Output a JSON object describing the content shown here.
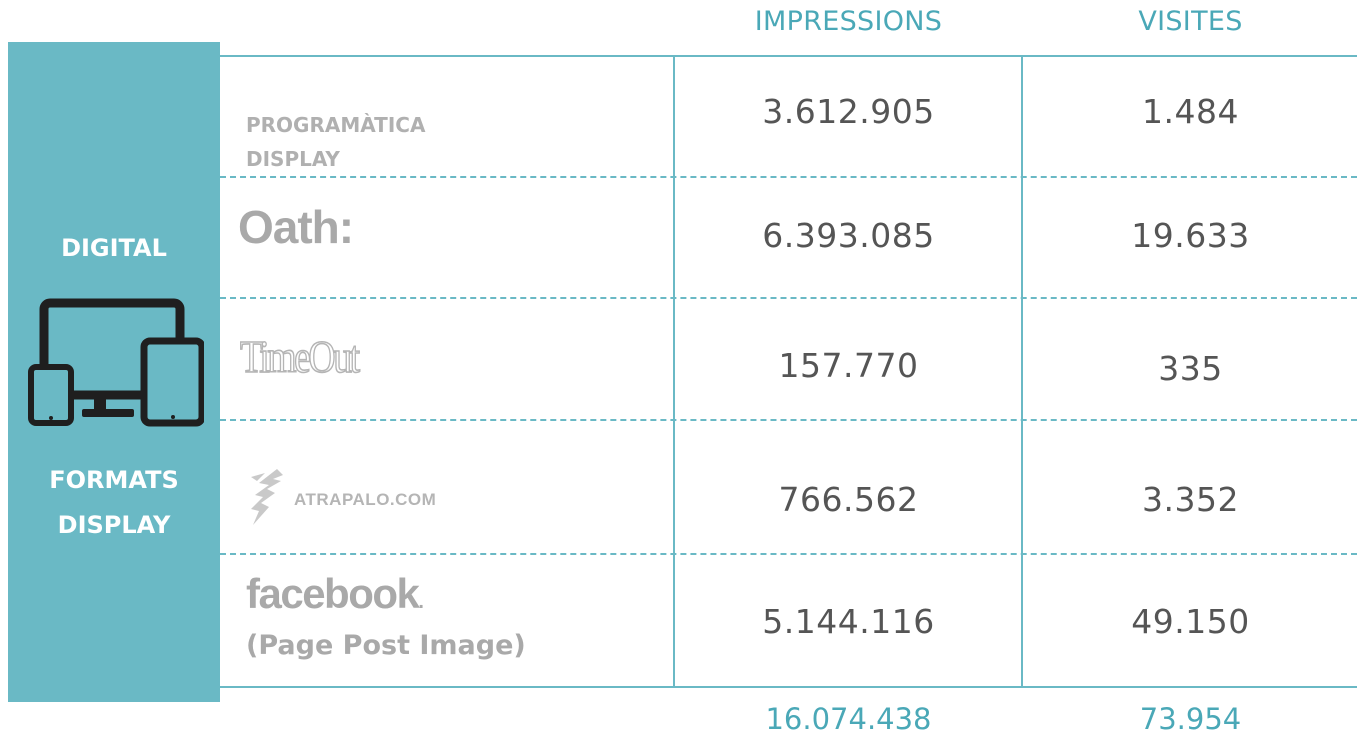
{
  "sidebar": {
    "top_label": "DIGITAL",
    "bottom_label_line1": "FORMATS",
    "bottom_label_line2": "DISPLAY",
    "icon": "devices-icon"
  },
  "columns": {
    "impressions": "IMPRESSIONS",
    "visites": "VISITES"
  },
  "rows": [
    {
      "name_line1": "PROGRAMÀTICA",
      "name_line2": "DISPLAY",
      "impressions": "3.612.905",
      "visites": "1.484"
    },
    {
      "logo": "Oath:",
      "impressions": "6.393.085",
      "visites": "19.633"
    },
    {
      "logo": "TimeOut",
      "impressions": "157.770",
      "visites": "335"
    },
    {
      "logo": "ATRAPALO.COM",
      "logo_icon": "atrapalo-icon",
      "impressions": "766.562",
      "visites": "3.352"
    },
    {
      "logo": "facebook",
      "logo_suffix": ".",
      "sub": "(Page Post Image)",
      "impressions": "5.144.116",
      "visites": "49.150"
    }
  ],
  "totals": {
    "impressions": "16.074.438",
    "visites": "73.954"
  },
  "colors": {
    "accent": "#6ab9c5",
    "accent_text": "#4aa8b7",
    "logo_gray": "#a9a9a9"
  }
}
